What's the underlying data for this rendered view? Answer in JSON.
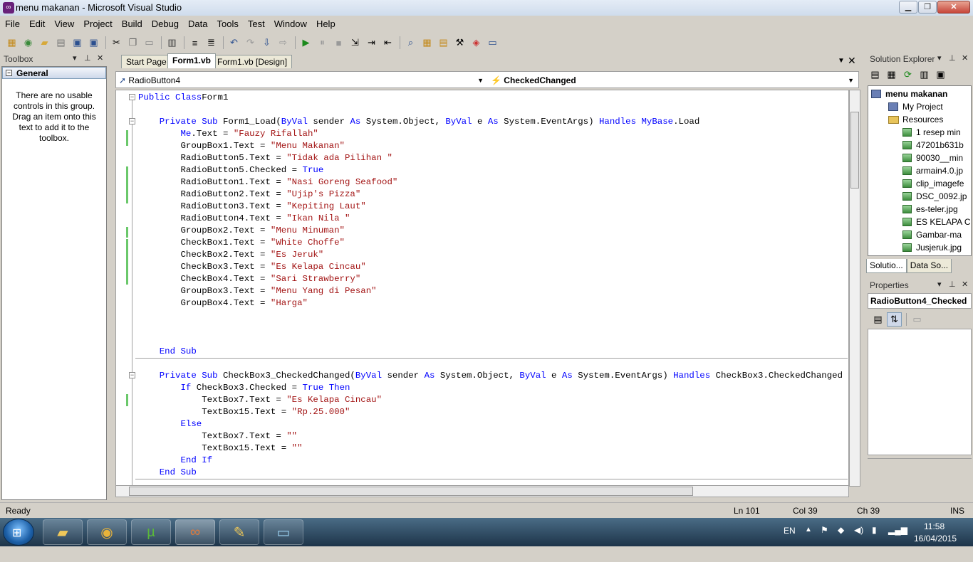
{
  "window": {
    "title": "menu makanan - Microsoft Visual Studio",
    "min": "▁",
    "max": "❐",
    "close": "✕"
  },
  "menu": [
    "File",
    "Edit",
    "View",
    "Project",
    "Build",
    "Debug",
    "Data",
    "Tools",
    "Test",
    "Window",
    "Help"
  ],
  "toolbox": {
    "title": "Toolbox",
    "group": "General",
    "message": "There are no usable controls in this group. Drag an item onto this text to add it to the toolbox."
  },
  "tabs": [
    "Start Page",
    "Form1.vb",
    "Form1.vb [Design]"
  ],
  "nav": {
    "object": "RadioButton4",
    "event": "CheckedChanged"
  },
  "code": [
    [
      [
        "kw",
        "Public Class"
      ],
      [
        "",
        "Form1"
      ]
    ],
    [],
    [
      [
        "",
        "    "
      ],
      [
        "kw",
        "Private Sub"
      ],
      [
        "",
        " Form1_Load("
      ],
      [
        "kw",
        "ByVal"
      ],
      [
        "",
        " sender "
      ],
      [
        "kw",
        "As"
      ],
      [
        "",
        " System.Object, "
      ],
      [
        "kw",
        "ByVal"
      ],
      [
        "",
        " e "
      ],
      [
        "kw",
        "As"
      ],
      [
        "",
        " System.EventArgs) "
      ],
      [
        "kw",
        "Handles"
      ],
      [
        "kw",
        " MyBase"
      ],
      [
        "",
        ".Load"
      ]
    ],
    [
      [
        "",
        "        "
      ],
      [
        "kw",
        "Me"
      ],
      [
        "",
        ".Text = "
      ],
      [
        "str",
        "\"Fauzy Rifallah\""
      ]
    ],
    [
      [
        "",
        "        GroupBox1.Text = "
      ],
      [
        "str",
        "\"Menu Makanan\""
      ]
    ],
    [
      [
        "",
        "        RadioButton5.Text = "
      ],
      [
        "str",
        "\"Tidak ada Pilihan \""
      ]
    ],
    [
      [
        "",
        "        RadioButton5.Checked = "
      ],
      [
        "kw",
        "True"
      ]
    ],
    [
      [
        "",
        "        RadioButton1.Text = "
      ],
      [
        "str",
        "\"Nasi Goreng Seafood\""
      ]
    ],
    [
      [
        "",
        "        RadioButton2.Text = "
      ],
      [
        "str",
        "\"Ujip's Pizza\""
      ]
    ],
    [
      [
        "",
        "        RadioButton3.Text = "
      ],
      [
        "str",
        "\"Kepiting Laut\""
      ]
    ],
    [
      [
        "",
        "        RadioButton4.Text = "
      ],
      [
        "str",
        "\"Ikan Nila \""
      ]
    ],
    [
      [
        "",
        "        GroupBox2.Text = "
      ],
      [
        "str",
        "\"Menu Minuman\""
      ]
    ],
    [
      [
        "",
        "        CheckBox1.Text = "
      ],
      [
        "str",
        "\"White Choffe\""
      ]
    ],
    [
      [
        "",
        "        CheckBox2.Text = "
      ],
      [
        "str",
        "\"Es Jeruk\""
      ]
    ],
    [
      [
        "",
        "        CheckBox3.Text = "
      ],
      [
        "str",
        "\"Es Kelapa Cincau\""
      ]
    ],
    [
      [
        "",
        "        CheckBox4.Text = "
      ],
      [
        "str",
        "\"Sari Strawberry\""
      ]
    ],
    [
      [
        "",
        "        GroupBox3.Text = "
      ],
      [
        "str",
        "\"Menu Yang di Pesan\""
      ]
    ],
    [
      [
        "",
        "        GroupBox4.Text = "
      ],
      [
        "str",
        "\"Harga\""
      ]
    ],
    [],
    [],
    [],
    [
      [
        "",
        "    "
      ],
      [
        "kw",
        "End Sub"
      ]
    ],
    [],
    [
      [
        "",
        "    "
      ],
      [
        "kw",
        "Private Sub"
      ],
      [
        "",
        " CheckBox3_CheckedChanged("
      ],
      [
        "kw",
        "ByVal"
      ],
      [
        "",
        " sender "
      ],
      [
        "kw",
        "As"
      ],
      [
        "",
        " System.Object, "
      ],
      [
        "kw",
        "ByVal"
      ],
      [
        "",
        " e "
      ],
      [
        "kw",
        "As"
      ],
      [
        "",
        " System.EventArgs) "
      ],
      [
        "kw",
        "Handles"
      ],
      [
        "",
        " CheckBox3.CheckedChanged"
      ]
    ],
    [
      [
        "",
        "        "
      ],
      [
        "kw",
        "If"
      ],
      [
        "",
        " CheckBox3.Checked = "
      ],
      [
        "kw",
        "True Then"
      ]
    ],
    [
      [
        "",
        "            TextBox7.Text = "
      ],
      [
        "str",
        "\"Es Kelapa Cincau\""
      ]
    ],
    [
      [
        "",
        "            TextBox15.Text = "
      ],
      [
        "str",
        "\"Rp.25.000\""
      ]
    ],
    [
      [
        "",
        "        "
      ],
      [
        "kw",
        "Else"
      ]
    ],
    [
      [
        "",
        "            TextBox7.Text = "
      ],
      [
        "str",
        "\"\""
      ]
    ],
    [
      [
        "",
        "            TextBox15.Text = "
      ],
      [
        "str",
        "\"\""
      ]
    ],
    [
      [
        "",
        "        "
      ],
      [
        "kw",
        "End If"
      ]
    ],
    [
      [
        "",
        "    "
      ],
      [
        "kw",
        "End Sub"
      ]
    ]
  ],
  "solution": {
    "title": "Solution Explorer",
    "project": "menu makanan",
    "items": [
      {
        "label": "My Project",
        "type": "proj"
      },
      {
        "label": "Resources",
        "type": "folder"
      },
      {
        "label": "1 resep min",
        "type": "img"
      },
      {
        "label": "47201b631b",
        "type": "img"
      },
      {
        "label": "90030__min",
        "type": "img"
      },
      {
        "label": "armain4.0.jp",
        "type": "img"
      },
      {
        "label": "clip_imagefe",
        "type": "img"
      },
      {
        "label": "DSC_0092.jp",
        "type": "img"
      },
      {
        "label": "es-teler.jpg",
        "type": "img"
      },
      {
        "label": "ES KELAPA C",
        "type": "img"
      },
      {
        "label": "Gambar-ma",
        "type": "img"
      },
      {
        "label": "Jusjeruk.jpg",
        "type": "img"
      }
    ],
    "tab_solution": "Solutio...",
    "tab_data": "Data So..."
  },
  "properties": {
    "title": "Properties",
    "object": "RadioButton4_Checked"
  },
  "status": {
    "ready": "Ready",
    "ln": "Ln 101",
    "col": "Col 39",
    "ch": "Ch 39",
    "ins": "INS"
  },
  "tray": {
    "lang": "EN",
    "time": "11:58",
    "date": "16/04/2015"
  }
}
